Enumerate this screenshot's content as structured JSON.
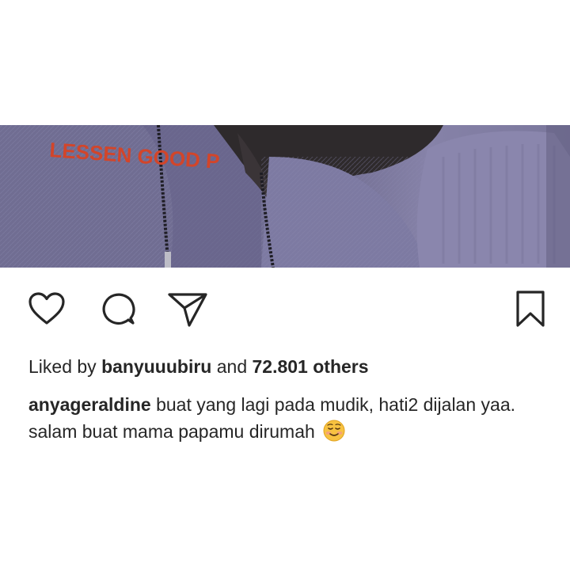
{
  "post": {
    "image": {
      "shirt_text": "LESSEN GOOD P",
      "colors": {
        "sweater": "#76739a",
        "hair": "#2e2a2c",
        "print": "#d2452a"
      }
    },
    "actions": {
      "like_icon": "heart-icon",
      "comment_icon": "comment-icon",
      "share_icon": "send-icon",
      "save_icon": "bookmark-icon"
    },
    "likes": {
      "prefix": "Liked by",
      "user": "banyuuubiru",
      "middle": "and",
      "count": "72.801 others"
    },
    "caption": {
      "username": "anyageraldine",
      "text": "buat yang lagi pada mudik, hati2 dijalan yaa. salam buat mama papamu dirumah",
      "emoji": "smiling-face-emoji"
    }
  }
}
